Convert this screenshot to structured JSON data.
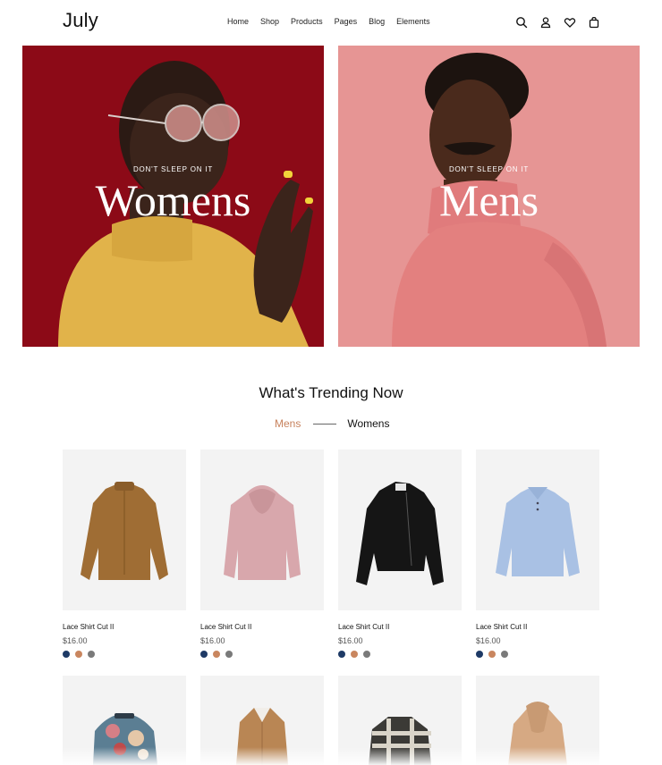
{
  "header": {
    "logo": "July",
    "nav": [
      "Home",
      "Shop",
      "Products",
      "Pages",
      "Blog",
      "Elements"
    ]
  },
  "hero": {
    "womens": {
      "kicker": "DON'T SLEEP ON IT",
      "title": "Womens"
    },
    "mens": {
      "kicker": "DON'T SLEEP ON IT",
      "title": "Mens"
    }
  },
  "trending": {
    "title": "What's Trending Now",
    "tab_active": "Mens",
    "tab_other": "Womens"
  },
  "products": [
    {
      "name": "Lace Shirt Cut II",
      "price": "$16.00"
    },
    {
      "name": "Lace Shirt Cut II",
      "price": "$16.00"
    },
    {
      "name": "Lace Shirt Cut II",
      "price": "$16.00"
    },
    {
      "name": "Lace Shirt Cut II",
      "price": "$16.00"
    }
  ],
  "colors": {
    "accent": "#c7825d",
    "swatch_navy": "#1e3a66",
    "swatch_tan": "#c9865f",
    "swatch_grey": "#7a7a7a",
    "womens_bg": "#8c0a17",
    "mens_bg": "#e69594"
  }
}
